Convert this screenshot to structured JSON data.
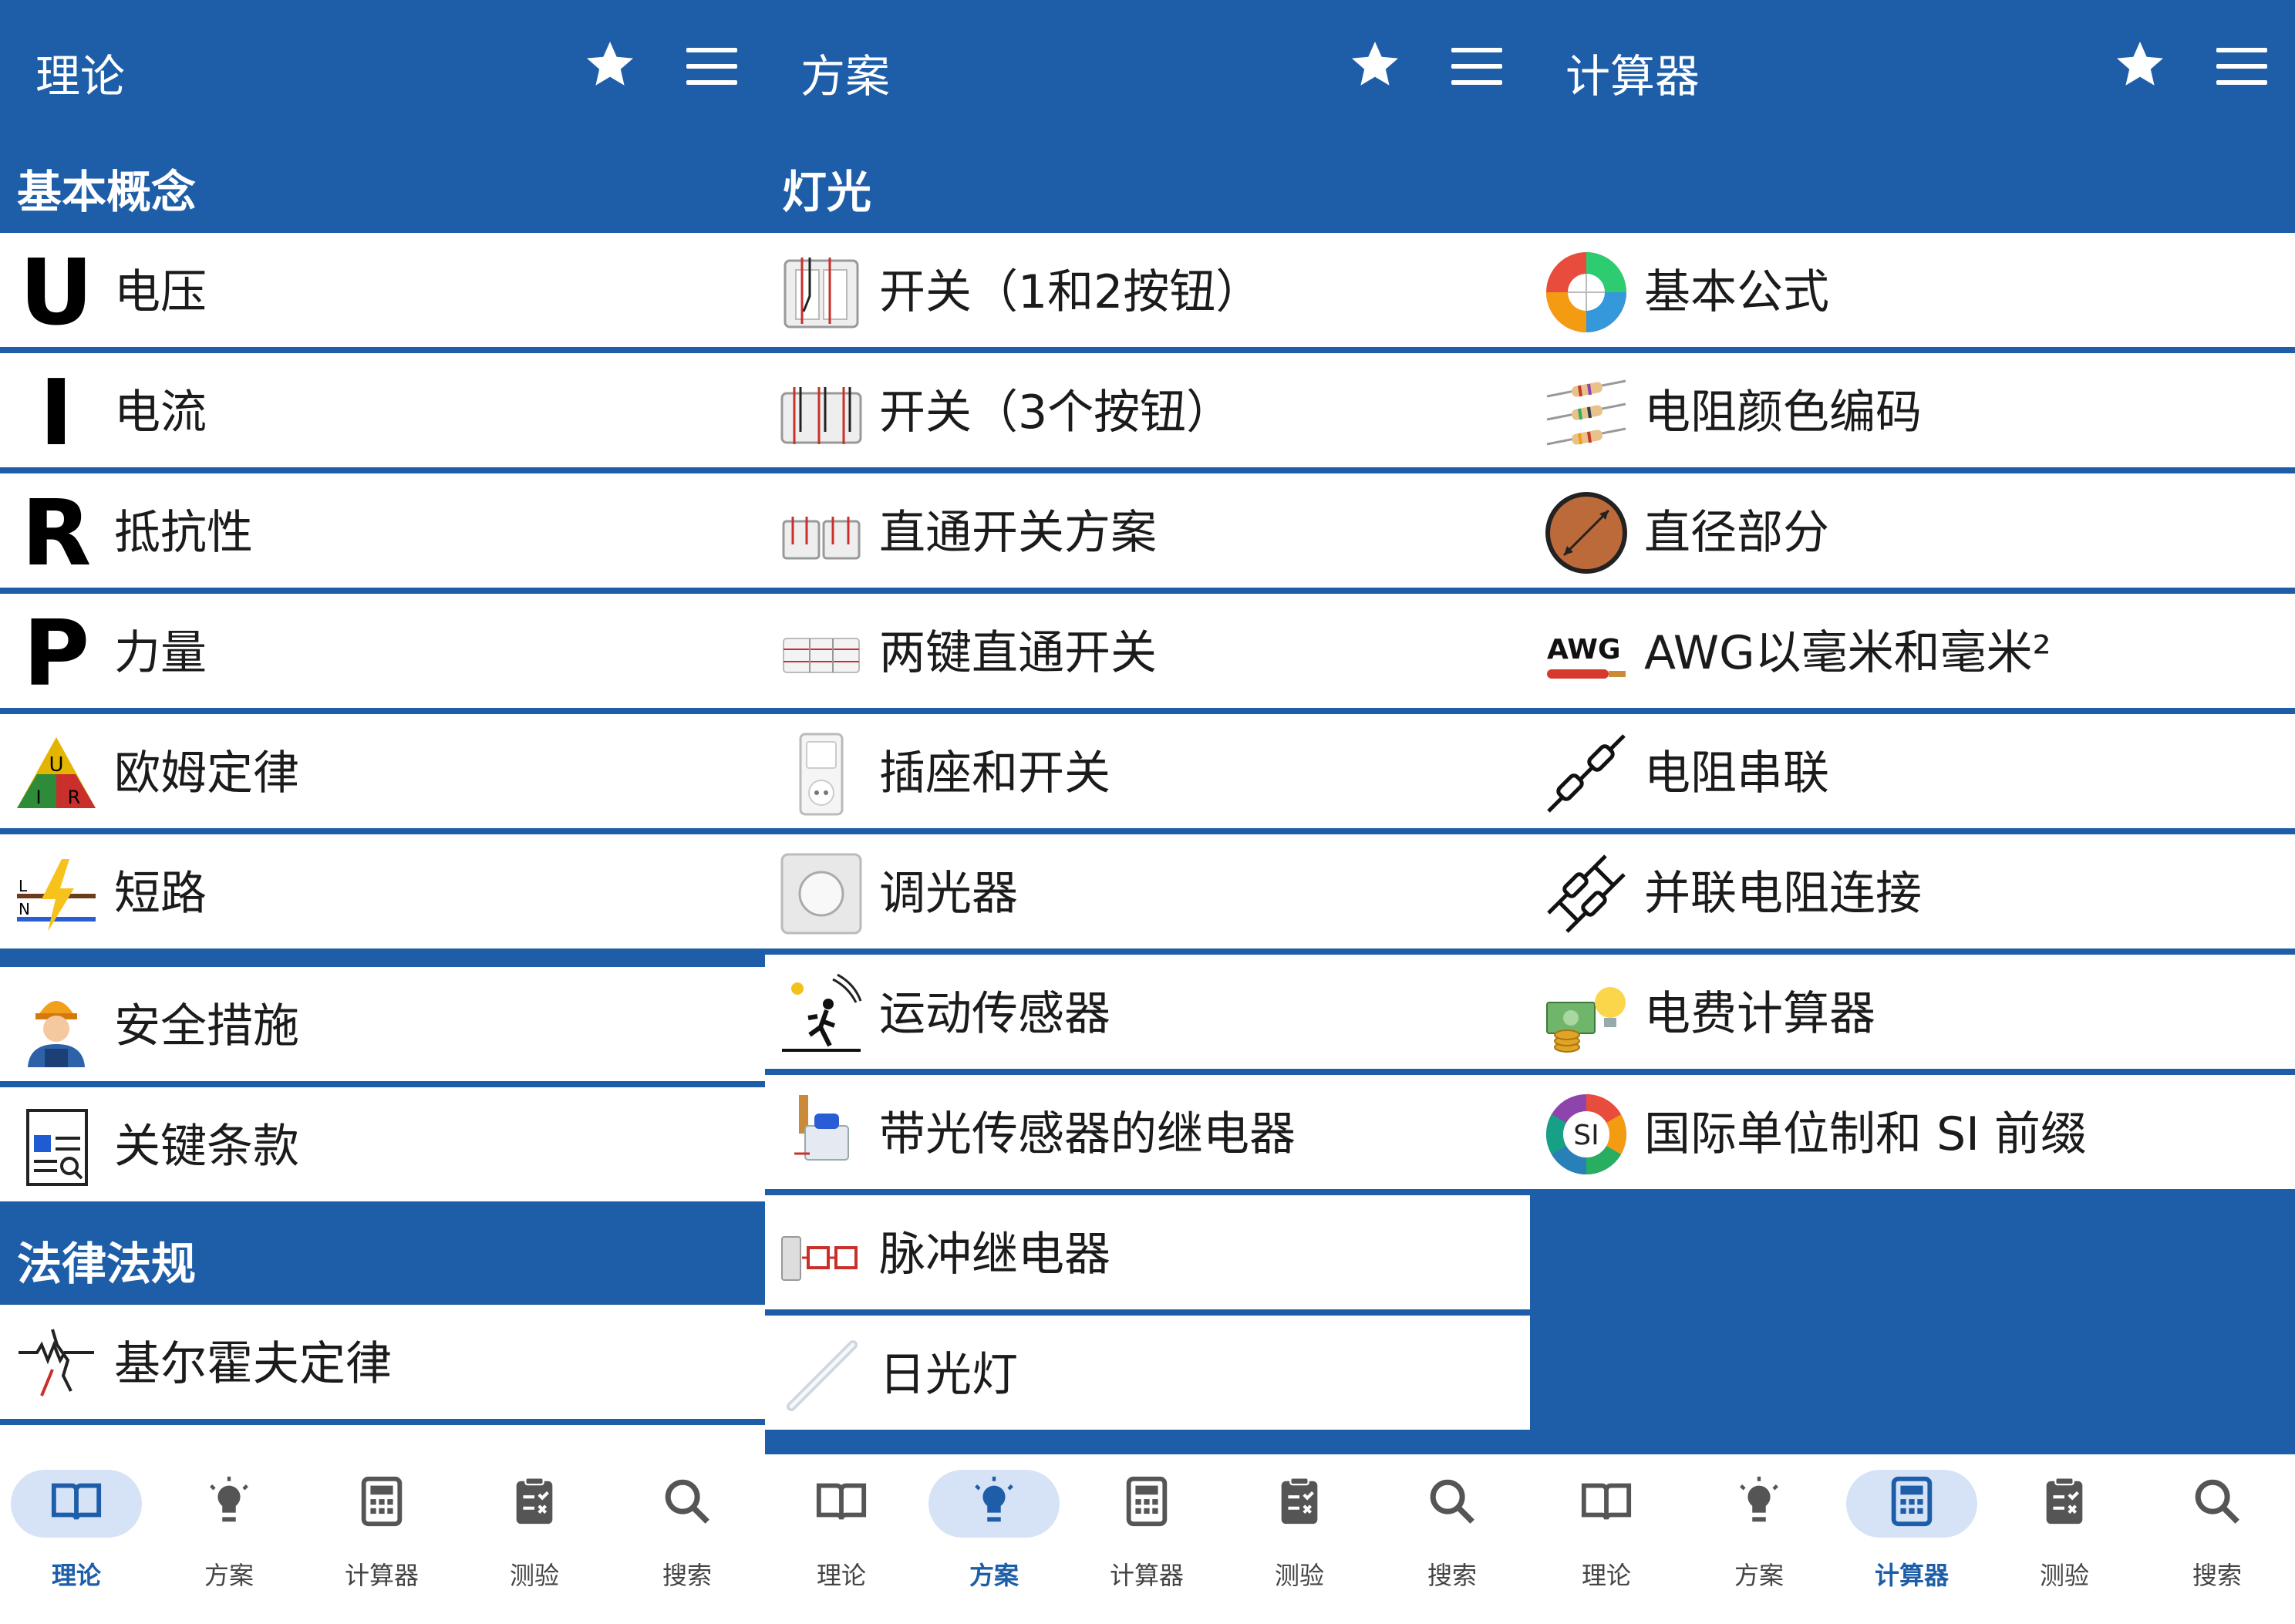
{
  "colors": {
    "primary": "#1e5ea8",
    "row_bg": "#ffffff",
    "tab_active_bg": "#d6e3f7",
    "tab_inactive": "#555555"
  },
  "panels": [
    {
      "header": {
        "title": "理论"
      },
      "sections": [
        {
          "title": "基本概念"
        },
        {
          "title": "法律法规"
        }
      ],
      "items": [
        {
          "label": "电压",
          "icon": "voltage-u-icon"
        },
        {
          "label": "电流",
          "icon": "current-i-icon"
        },
        {
          "label": "抵抗性",
          "icon": "resistance-r-icon"
        },
        {
          "label": "力量",
          "icon": "power-p-icon"
        },
        {
          "label": "欧姆定律",
          "icon": "ohm-triangle-icon"
        },
        {
          "label": "短路",
          "icon": "short-circuit-icon"
        },
        {
          "label": "安全措施",
          "icon": "worker-icon"
        },
        {
          "label": "关键条款",
          "icon": "glossary-icon"
        },
        {
          "label": "基尔霍夫定律",
          "icon": "kirchhoff-icon"
        }
      ],
      "active_tab": 0
    },
    {
      "header": {
        "title": "方案"
      },
      "sections": [
        {
          "title": "灯光"
        }
      ],
      "items": [
        {
          "label": "开关（1和2按钮）",
          "icon": "switch-1-2-icon"
        },
        {
          "label": "开关（3个按钮）",
          "icon": "switch-3-icon"
        },
        {
          "label": "直通开关方案",
          "icon": "passthrough-switch-icon"
        },
        {
          "label": "两键直通开关",
          "icon": "two-key-switch-icon"
        },
        {
          "label": "插座和开关",
          "icon": "socket-switch-icon"
        },
        {
          "label": "调光器",
          "icon": "dimmer-icon"
        },
        {
          "label": "运动传感器",
          "icon": "motion-sensor-icon"
        },
        {
          "label": "带光传感器的继电器",
          "icon": "light-sensor-relay-icon"
        },
        {
          "label": "脉冲继电器",
          "icon": "pulse-relay-icon"
        },
        {
          "label": "日光灯",
          "icon": "fluorescent-lamp-icon"
        }
      ],
      "active_tab": 1
    },
    {
      "header": {
        "title": "计算器"
      },
      "items": [
        {
          "label": "基本公式",
          "icon": "formula-wheel-icon"
        },
        {
          "label": "电阻颜色编码",
          "icon": "resistor-color-icon"
        },
        {
          "label": "直径部分",
          "icon": "diameter-icon"
        },
        {
          "label": "AWG以毫米和毫米²",
          "icon": "awg-icon",
          "badge": "AWG"
        },
        {
          "label": "电阻串联",
          "icon": "series-resistor-icon"
        },
        {
          "label": "并联电阻连接",
          "icon": "parallel-resistor-icon"
        },
        {
          "label": "电费计算器",
          "icon": "electricity-cost-icon"
        },
        {
          "label": "国际单位制和 SI 前缀",
          "icon": "si-units-icon",
          "badge": "SI"
        }
      ],
      "active_tab": 2
    }
  ],
  "icon_letters": {
    "u": "U",
    "i": "I",
    "r": "R",
    "p": "P",
    "ohm_u": "U",
    "ohm_i": "I",
    "ohm_r": "R",
    "sc_l": "L",
    "sc_n": "N"
  },
  "tabs": [
    {
      "label": "理论",
      "icon": "book-icon"
    },
    {
      "label": "方案",
      "icon": "bulb-icon"
    },
    {
      "label": "计算器",
      "icon": "calculator-icon"
    },
    {
      "label": "测验",
      "icon": "quiz-icon"
    },
    {
      "label": "搜索",
      "icon": "search-icon"
    }
  ]
}
